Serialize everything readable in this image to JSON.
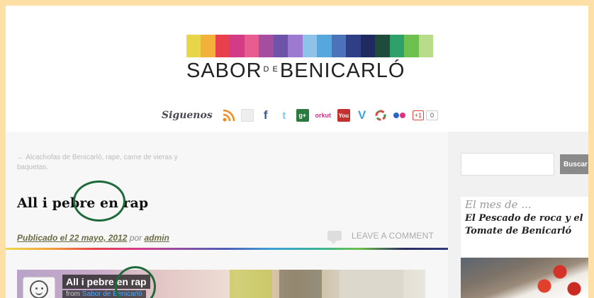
{
  "site": {
    "logo_left": "SABOR",
    "logo_de": "D E",
    "logo_right": "BENICARLÓ",
    "logo_colors": [
      "#e8d64a",
      "#f2b13a",
      "#e8404c",
      "#d43b85",
      "#e85d8f",
      "#a54d9e",
      "#6e54a8",
      "#9d7ad0",
      "#8fc2e8",
      "#56a7de",
      "#4b73b9",
      "#2f3f85",
      "#1f2b5e",
      "#1f4b3b",
      "#2ea06a",
      "#6ec04f",
      "#b9dc8a"
    ]
  },
  "social": {
    "label": "Siguenos",
    "icons": [
      "rss-icon",
      "email-icon",
      "facebook-icon",
      "twitter-icon",
      "google-plus-icon",
      "orkut-icon",
      "youtube-icon",
      "vimeo-icon",
      "picasa-icon",
      "flickr-icon"
    ],
    "plusone_label": "+1",
    "plusone_count": "0"
  },
  "post": {
    "prev_link": "← Alcachofas de Benicarló, rape, carne de vieras y baquetas.",
    "title": "All i pebre en rap",
    "published_prefix": "Publicado el 22 mayo, 2012",
    "by": "por",
    "author": "admin",
    "comment_label": "LEAVE A COMMENT",
    "video_title": "All i pebre en rap",
    "video_from_prefix": "from",
    "video_from": "Sabor de Benicarló"
  },
  "sidebar": {
    "search_button": "Buscar",
    "search_value": "",
    "promo_title": "El mes de ...",
    "promo_subtitle": "El Pescado de roca y el Tomate de Benicarló"
  }
}
